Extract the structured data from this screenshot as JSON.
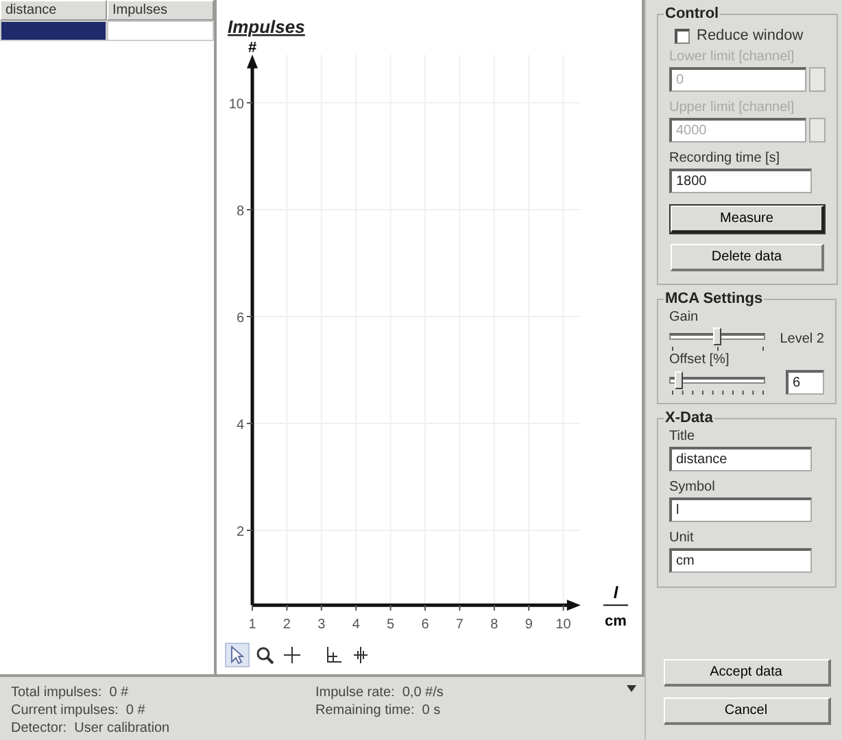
{
  "table": {
    "columns": [
      "distance",
      "Impulses"
    ],
    "rows": [
      {
        "cells": [
          "",
          ""
        ],
        "selected": true
      }
    ]
  },
  "chart": {
    "chart_data": {
      "type": "line",
      "grid": true,
      "title": "Impulses",
      "ylabel": "#",
      "xlabel": "l",
      "xlim": [
        1,
        10.5
      ],
      "ylim": [
        0.6,
        10.9
      ],
      "xticks": [
        1,
        2,
        3,
        4,
        5,
        6,
        7,
        8,
        9,
        10
      ],
      "yticks": [
        2,
        4,
        6,
        8,
        10
      ]
    },
    "x_unit": "cm"
  },
  "chart_tools": [
    {
      "kind": "pointer",
      "selected": true
    },
    {
      "kind": "zoom",
      "selected": false
    },
    {
      "kind": "crosshair",
      "selected": false
    },
    {
      "kind": "axes",
      "selected": false
    },
    {
      "kind": "move",
      "selected": false
    }
  ],
  "status": {
    "left": [
      "Total impulses:  0 #",
      "Current impulses:  0 #",
      "Detector:  User calibration"
    ],
    "right": [
      "Impulse rate:  0,0 #/s",
      "Remaining time:  0 s"
    ]
  },
  "control": {
    "title": "Control",
    "reduce_window": {
      "label": "Reduce window",
      "checked": false
    },
    "fields": [
      {
        "label": "Lower limit [channel]",
        "value": "0",
        "disabled": true,
        "spinner": true
      },
      {
        "label": "Upper limit [channel]",
        "value": "4000",
        "disabled": true,
        "spinner": true
      },
      {
        "label": "Recording time [s]",
        "value": "1800",
        "disabled": false,
        "spinner": false
      }
    ],
    "buttons": [
      {
        "label": "Measure",
        "default": true
      },
      {
        "label": "Delete data",
        "default": false
      }
    ]
  },
  "mca": {
    "title": "MCA Settings",
    "gain": {
      "label": "Gain",
      "level": 0.5,
      "reading": "Level 2"
    },
    "offset": {
      "label": "Offset [%]",
      "level": 0.06,
      "value": "6"
    }
  },
  "xdata": {
    "title": "X-Data",
    "fields": [
      {
        "label": "Title",
        "value": "distance"
      },
      {
        "label": "Symbol",
        "value": "l"
      },
      {
        "label": "Unit",
        "value": "cm"
      }
    ]
  },
  "buttons": [
    {
      "label": "Accept data"
    },
    {
      "label": "Cancel"
    }
  ]
}
